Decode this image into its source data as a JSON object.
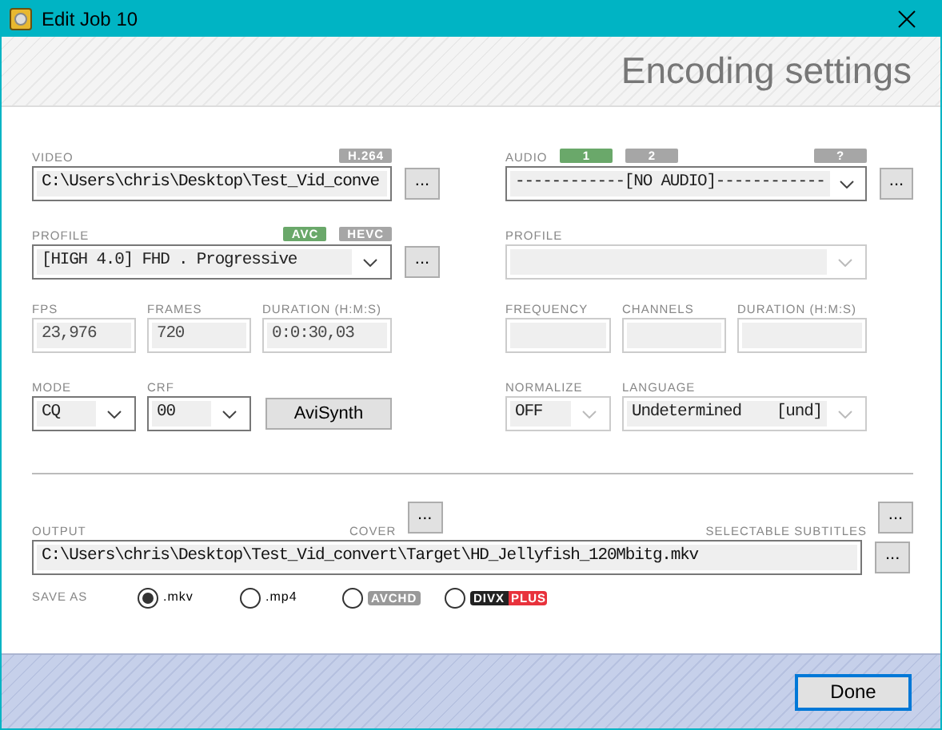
{
  "window": {
    "title": "Edit Job 10"
  },
  "header": {
    "title": "Encoding settings"
  },
  "video": {
    "label": "VIDEO",
    "badges": [
      {
        "text": "H.264",
        "selected": false
      }
    ],
    "file": {
      "value": "C:\\Users\\chris\\Desktop\\Test_Vid_conve"
    },
    "browse": "..."
  },
  "video_profile": {
    "label": "PROFILE",
    "badges": [
      {
        "text": "AVC",
        "selected": true
      },
      {
        "text": "HEVC",
        "selected": false
      }
    ],
    "dropdown": {
      "value": "[HIGH 4.0] FHD . Progressive",
      "disabled": false
    },
    "browse": "..."
  },
  "video_stats": [
    {
      "label": "FPS",
      "value": "23,976",
      "disabled": true
    },
    {
      "label": "FRAMES",
      "value": "720",
      "disabled": true
    },
    {
      "label": "DURATION (H:M:S)",
      "value": "0:0:30,03",
      "disabled": true
    }
  ],
  "video_mode": {
    "mode": {
      "label": "MODE",
      "value": "CQ"
    },
    "crf": {
      "label": "CRF",
      "value": "00"
    },
    "avisynth": "AviSynth"
  },
  "audio": {
    "label": "AUDIO",
    "tracks": [
      {
        "text": "1",
        "selected": true
      },
      {
        "text": "2",
        "selected": false
      }
    ],
    "help": {
      "text": "?",
      "selected": false
    },
    "dropdown": {
      "value": "------------[NO AUDIO]------------",
      "disabled": false
    },
    "browse": "..."
  },
  "audio_profile": {
    "label": "PROFILE",
    "dropdown": {
      "disabled": true
    }
  },
  "audio_stats": [
    {
      "label": "FREQUENCY",
      "disabled": true
    },
    {
      "label": "CHANNELS",
      "disabled": true
    },
    {
      "label": "DURATION (H:M:S)",
      "disabled": true
    }
  ],
  "audio_options": {
    "normalize": {
      "label": "NORMALIZE",
      "value": "OFF"
    },
    "language": {
      "label": "LANGUAGE",
      "value": "Undetermined",
      "code": "[und]"
    }
  },
  "output": {
    "label": "OUTPUT",
    "cover_label": "COVER",
    "cover_browse": "...",
    "subtitles_label": "SELECTABLE SUBTITLES",
    "subtitles_browse": "...",
    "value": "C:\\Users\\chris\\Desktop\\Test_Vid_convert\\Target\\HD_Jellyfish_120Mbitg.mkv",
    "browse": "..."
  },
  "save_as": {
    "label": "SAVE AS",
    "options": [
      {
        "kind": "text",
        "text": ".mkv",
        "selected": true
      },
      {
        "kind": "text",
        "text": ".mp4",
        "selected": false
      },
      {
        "kind": "badge",
        "text": "AVCHD",
        "selected": false
      },
      {
        "kind": "split_badge",
        "text": "DIVX",
        "text2": "PLUS",
        "selected": false
      }
    ]
  },
  "footer": {
    "done": "Done"
  }
}
